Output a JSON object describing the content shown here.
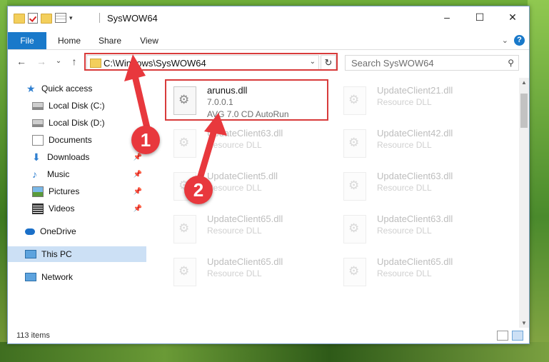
{
  "window": {
    "title": "SysWOW64",
    "controls": {
      "minimize": "–",
      "maximize": "☐",
      "close": "✕"
    }
  },
  "ribbon": {
    "tabs": [
      "File",
      "Home",
      "Share",
      "View"
    ],
    "expand_glyph": "⌄",
    "help_glyph": "?"
  },
  "navbar": {
    "back": "←",
    "forward": "→",
    "recent": "⌄",
    "up": "↑",
    "address": "C:\\Windows\\SysWOW64",
    "address_dropdown": "⌄",
    "refresh": "↻",
    "search_placeholder": "Search SysWOW64",
    "search_icon": "⚲"
  },
  "sidebar": {
    "quick_access": "Quick access",
    "items": [
      {
        "label": "Local Disk (C:)",
        "pinned": false
      },
      {
        "label": "Local Disk (D:)",
        "pinned": false
      },
      {
        "label": "Documents",
        "pinned": false
      },
      {
        "label": "Downloads",
        "pinned": true
      },
      {
        "label": "Music",
        "pinned": true
      },
      {
        "label": "Pictures",
        "pinned": true
      },
      {
        "label": "Videos",
        "pinned": true
      }
    ],
    "onedrive": "OneDrive",
    "this_pc": "This PC",
    "network": "Network",
    "pin_glyph": "📌"
  },
  "files": [
    {
      "name": "arunus.dll",
      "line2": "7.0.0.1",
      "line3": "AVG 7.0 CD AutoRun",
      "faded": false
    },
    {
      "name": "UpdateClient21.dll",
      "line2": "Resource DLL",
      "faded": true
    },
    {
      "name": "UpdateClient63.dll",
      "line2": "Resource DLL",
      "faded": true
    },
    {
      "name": "UpdateClient42.dll",
      "line2": "Resource DLL",
      "faded": true
    },
    {
      "name": "UpdateClient5.dll",
      "line2": "Resource DLL",
      "faded": true
    },
    {
      "name": "UpdateClient63.dll",
      "line2": "Resource DLL",
      "faded": true
    },
    {
      "name": "UpdateClient65.dll",
      "line2": "Resource DLL",
      "faded": true
    },
    {
      "name": "UpdateClient63.dll",
      "line2": "Resource DLL",
      "faded": true
    },
    {
      "name": "UpdateClient65.dll",
      "line2": "Resource DLL",
      "faded": true
    },
    {
      "name": "UpdateClient65.dll",
      "line2": "Resource DLL",
      "faded": true
    }
  ],
  "status": {
    "item_count": "113 items"
  },
  "annotations": {
    "step1": "1",
    "step2": "2",
    "highlight_color": "#d83b3b"
  }
}
